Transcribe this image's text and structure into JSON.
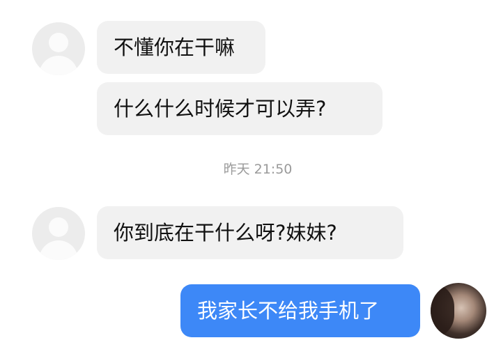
{
  "messages": [
    {
      "text": "不懂你在干嘛"
    },
    {
      "text": "什么什么时候才可以弄?"
    },
    {
      "text": "你到底在干什么呀?妹妹?"
    },
    {
      "text": "我家长不给我手机了"
    }
  ],
  "timestamp": "昨天 21:50",
  "colors": {
    "incoming_bubble": "#f1f1f1",
    "outgoing_bubble": "#3d88f7",
    "timestamp_text": "#9a9a9a"
  },
  "icons": {
    "contact_avatar": "default-person-avatar",
    "self_avatar": "user-photo-avatar"
  }
}
